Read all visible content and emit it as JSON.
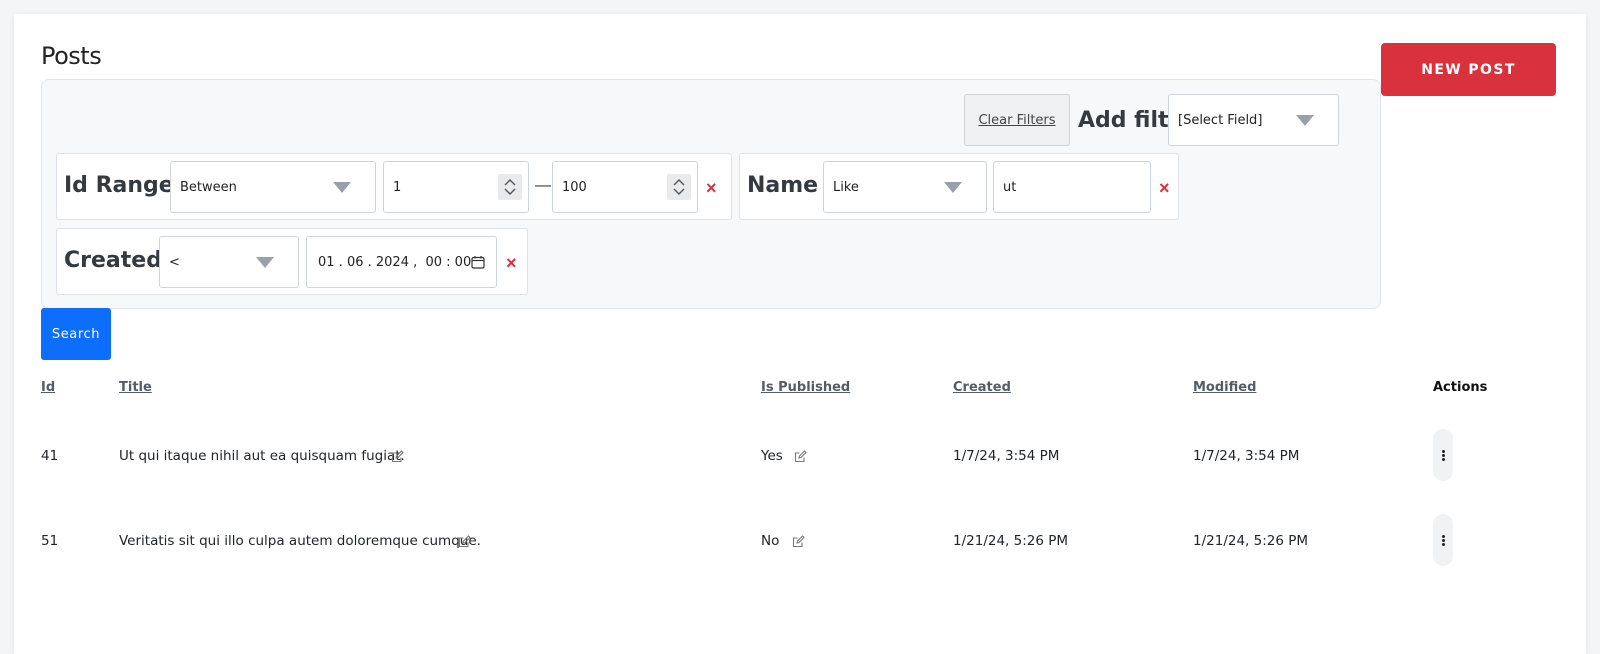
{
  "page": {
    "title": "Posts",
    "new_post_label": "NEW POST"
  },
  "filters": {
    "clear_label": "Clear Filters",
    "add_filter_label": "Add filter",
    "add_filter_select": "[Select Field]",
    "id_range": {
      "label": "Id Range",
      "operator": "Between",
      "from": "1",
      "separator": "—",
      "to": "100"
    },
    "name": {
      "label": "Name",
      "operator": "Like",
      "value": "ut"
    },
    "created": {
      "label": "Created",
      "operator": "<",
      "value": "01 . 06 . 2024 ,  00 : 00"
    },
    "remove_icon": "×"
  },
  "search_label": "Search",
  "table": {
    "headers": {
      "id": "Id",
      "title": "Title",
      "is_published": "Is Published",
      "created": "Created",
      "modified": "Modified",
      "actions": "Actions"
    },
    "rows": [
      {
        "id": "41",
        "title": "Ut qui itaque nihil aut ea quisquam fugiat.",
        "is_published": "Yes",
        "created": "1/7/24, 3:54 PM",
        "modified": "1/7/24, 3:54 PM"
      },
      {
        "id": "51",
        "title": "Veritatis sit qui illo culpa autem doloremque cumque.",
        "is_published": "No",
        "created": "1/21/24, 5:26 PM",
        "modified": "1/21/24, 5:26 PM"
      }
    ]
  },
  "colors": {
    "primary": "#0d6efd",
    "danger": "#d9323d",
    "panel_bg": "#f7f8fa"
  },
  "icons": {
    "edit": "edit-icon",
    "calendar": "calendar-icon",
    "kebab": "kebab-menu-icon",
    "remove": "close-icon"
  }
}
